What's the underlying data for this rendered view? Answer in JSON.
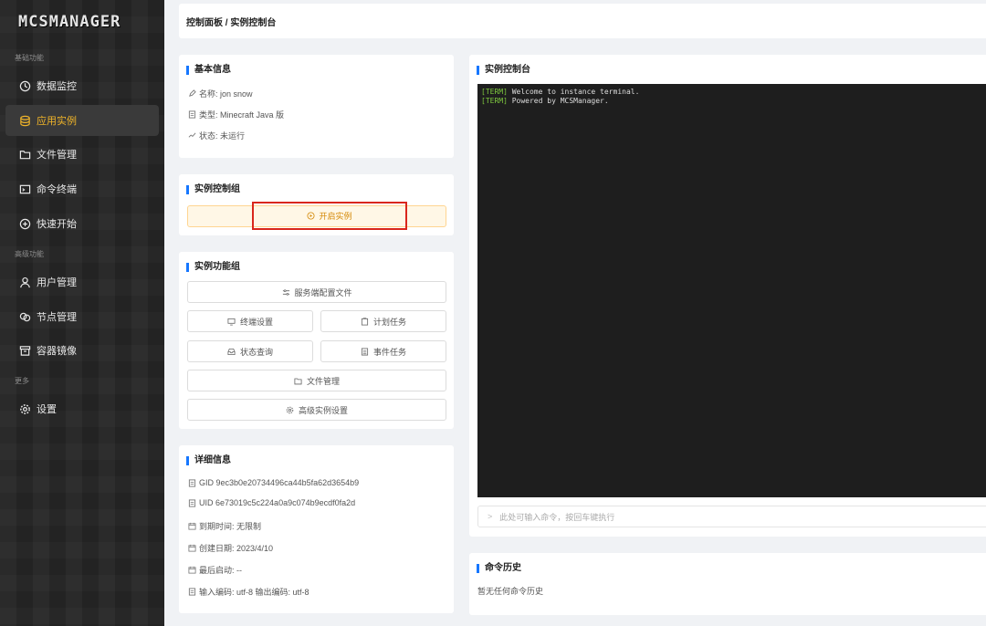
{
  "app": {
    "logo": "MCSMANAGER"
  },
  "sidebar": {
    "groups": [
      "基础功能",
      "高级功能",
      "更多"
    ],
    "items": [
      {
        "label": "数据监控",
        "icon": "dashboard-icon"
      },
      {
        "label": "应用实例",
        "icon": "database-icon",
        "active": true
      },
      {
        "label": "文件管理",
        "icon": "folder-icon"
      },
      {
        "label": "命令终端",
        "icon": "terminal-icon"
      },
      {
        "label": "快速开始",
        "icon": "plus-circle-icon"
      },
      {
        "label": "用户管理",
        "icon": "user-icon"
      },
      {
        "label": "节点管理",
        "icon": "node-icon"
      },
      {
        "label": "容器镜像",
        "icon": "box-icon"
      },
      {
        "label": "设置",
        "icon": "gear-icon"
      }
    ]
  },
  "header": {
    "breadcrumb": "控制面板 / 实例控制台"
  },
  "basic_info": {
    "title": "基本信息",
    "name": "名称: jon snow",
    "type": "类型: Minecraft Java 版",
    "status": "状态: 未运行"
  },
  "control_group": {
    "title": "实例控制组",
    "start_label": "开启实例"
  },
  "function_group": {
    "title": "实例功能组",
    "server_config": "服务端配置文件",
    "terminal_settings": "终端设置",
    "schedule": "计划任务",
    "status_query": "状态查询",
    "event_tasks": "事件任务",
    "file_manage": "文件管理",
    "advanced": "高级实例设置"
  },
  "details": {
    "title": "详细信息",
    "gid": "GID 9ec3b0e20734496ca44b5fa62d3654b9",
    "uid": "UID 6e73019c5c224a0a9c074b9ecdf0fa2d",
    "expire": "到期时间: 无限制",
    "created": "创建日期: 2023/4/10",
    "last_start": "最后启动: --",
    "encoding": "输入编码: utf-8 输出编码: utf-8"
  },
  "console": {
    "title": "实例控制台",
    "lines": [
      {
        "tag": "[TERM]",
        "text": " Welcome to instance terminal."
      },
      {
        "tag": "[TERM]",
        "text": " Powered by MCSManager."
      }
    ],
    "input_placeholder": "此处可输入命令，按回车键执行"
  },
  "history": {
    "title": "命令历史",
    "empty": "暂无任何命令历史"
  },
  "colors": {
    "accent": "#1677ff",
    "active_nav": "#f0b429",
    "start_border": "#d9261c",
    "term_tag": "#7ec93f"
  }
}
